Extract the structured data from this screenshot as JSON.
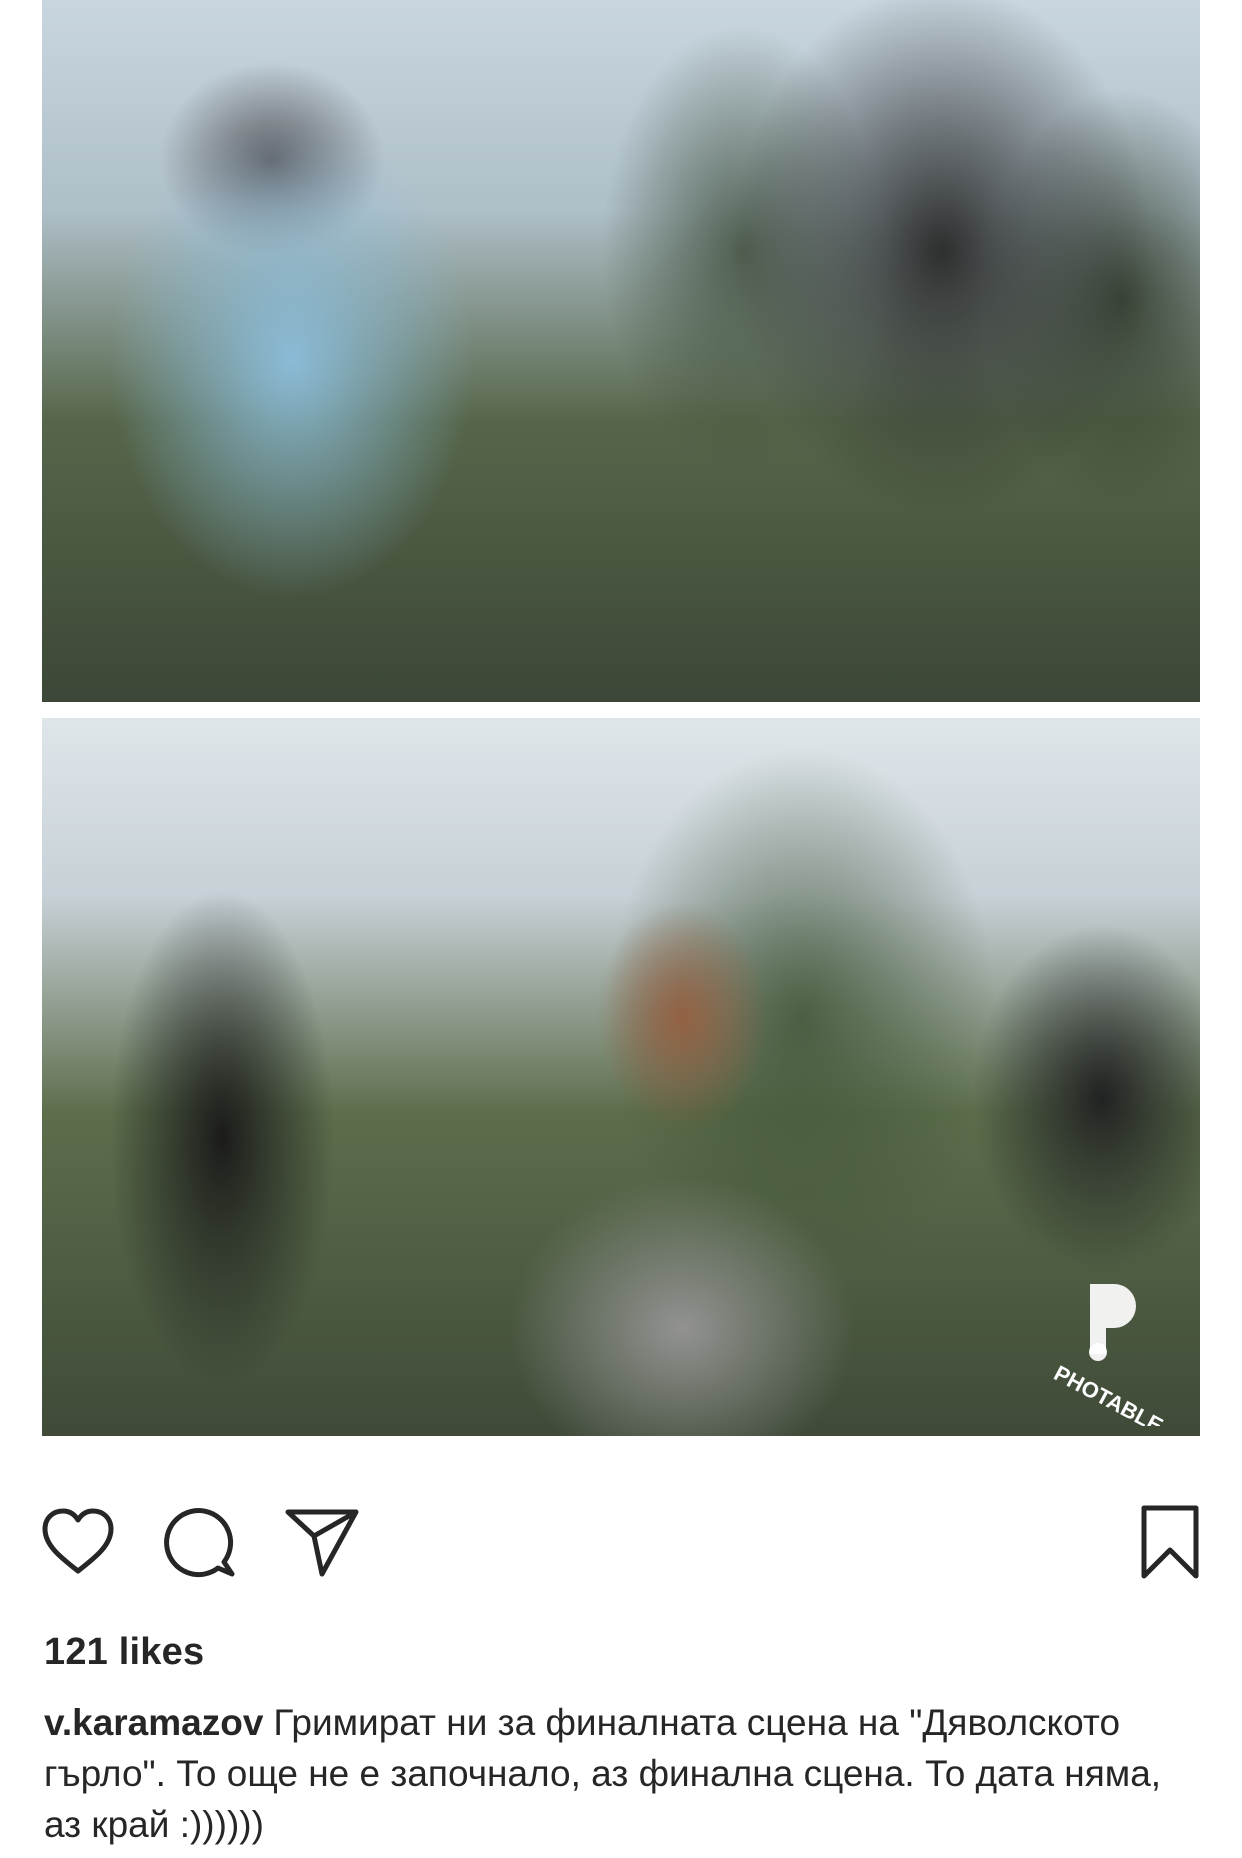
{
  "post": {
    "watermark_text": "PHOTABLE",
    "icons": {
      "like": "heart-icon",
      "comment": "comment-bubble-icon",
      "share": "paper-plane-icon",
      "save": "bookmark-icon"
    },
    "likes_count": "121",
    "likes_suffix": "likes",
    "caption": {
      "username": "v.karamazov",
      "text": "Гримират ни за финалната сцена на \"Дяволското гърло\". То още не е започнало, аз финална сцена. То дата няма, аз край :))))))"
    }
  },
  "colors": {
    "text": "#262626",
    "icon_stroke": "#262626",
    "background": "#ffffff"
  }
}
